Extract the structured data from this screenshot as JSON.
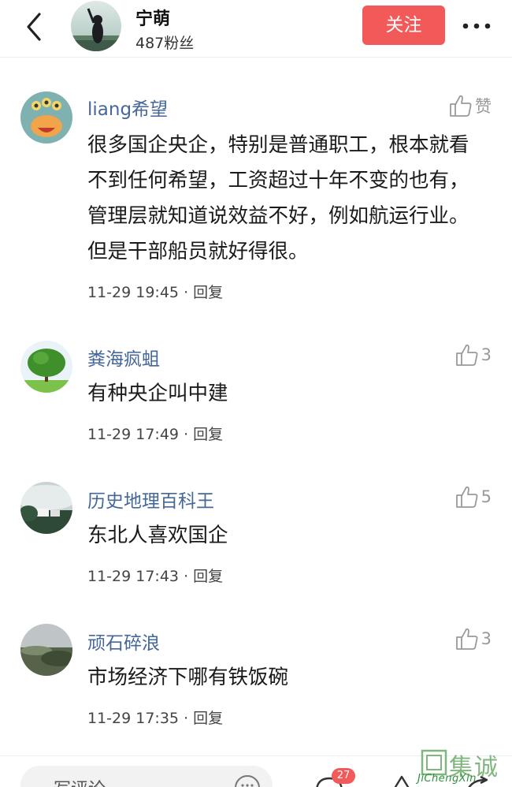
{
  "header": {
    "author_name": "宁萌",
    "fans": "487粉丝",
    "follow_label": "关注"
  },
  "comments": [
    {
      "user": "liang希望",
      "like": "赞",
      "text": "很多国企央企，特别是普通职工，根本就看不到任何希望，工资超过十年不变的也有，管理层就知道说效益不好，例如航运行业。但是干部船员就好得很。",
      "time": "11-29 19:45",
      "reply": "回复"
    },
    {
      "user": "粪海疯蛆",
      "like": "3",
      "text": "有种央企叫中建",
      "time": "11-29 17:49",
      "reply": "回复"
    },
    {
      "user": "历史地理百科王",
      "like": "5",
      "text": "东北人喜欢国企",
      "time": "11-29 17:43",
      "reply": "回复"
    },
    {
      "user": "顽石碎浪",
      "like": "3",
      "text": "市场经济下哪有铁饭碗",
      "time": "11-29 17:35",
      "reply": "回复"
    }
  ],
  "bottom": {
    "write_comment": "写评论",
    "comment_count": "27"
  },
  "watermark": {
    "cn": "集诚信",
    "url": "JiChengXin"
  },
  "colors": {
    "accent": "#f25a5a",
    "username": "#456799",
    "muted": "#999999"
  }
}
